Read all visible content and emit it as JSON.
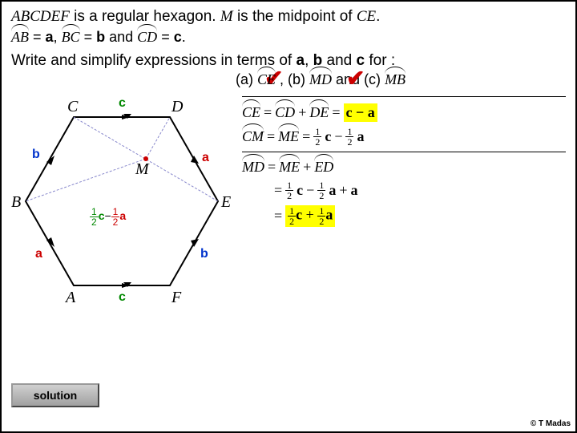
{
  "problem": {
    "hexagon_name": "ABCDEF",
    "intro_text1": " is a regular hexagon. ",
    "midpoint_var": "M",
    "intro_text2": " is the midpoint of ",
    "midpoint_of": "CE",
    "period": ".",
    "vec_ab": "AB",
    "eq": " = ",
    "a": "a",
    "comma": ", ",
    "vec_bc": "BC",
    "b": "b",
    "and_word": "  and  ",
    "vec_cd": "CD",
    "c": "c",
    "period2": ".",
    "instruction": "Write and simplify expressions in terms of ",
    "instruction_mid1": ", ",
    "instruction_mid2": " and ",
    "instruction_end": " for :",
    "parts": {
      "a_label": "(a)  ",
      "a_vec": "CE",
      "sep1": " ,  (b)  ",
      "b_vec": "MD",
      "sep2": "  and (c)  ",
      "c_vec": "MB"
    }
  },
  "diagram": {
    "v": {
      "A": "A",
      "B": "B",
      "C": "C",
      "D": "D",
      "E": "E",
      "F": "F",
      "M": "M"
    },
    "edge": {
      "a": "a",
      "b": "b",
      "c": "c"
    },
    "mid_expr_left": "½",
    "mid_c": "c",
    "mid_sep": "−",
    "mid_a": "½a"
  },
  "work": {
    "ce": "CE",
    "cd": "CD",
    "plus": "+",
    "de": "DE",
    "eq": "=",
    "minus": "−",
    "cm": "CM",
    "me": "ME",
    "md": "MD",
    "ed": "ED",
    "half": "½",
    "c": "c",
    "a": "a",
    "result1": "c − a"
  },
  "solution_label": "solution",
  "copyright": "© T Madas"
}
